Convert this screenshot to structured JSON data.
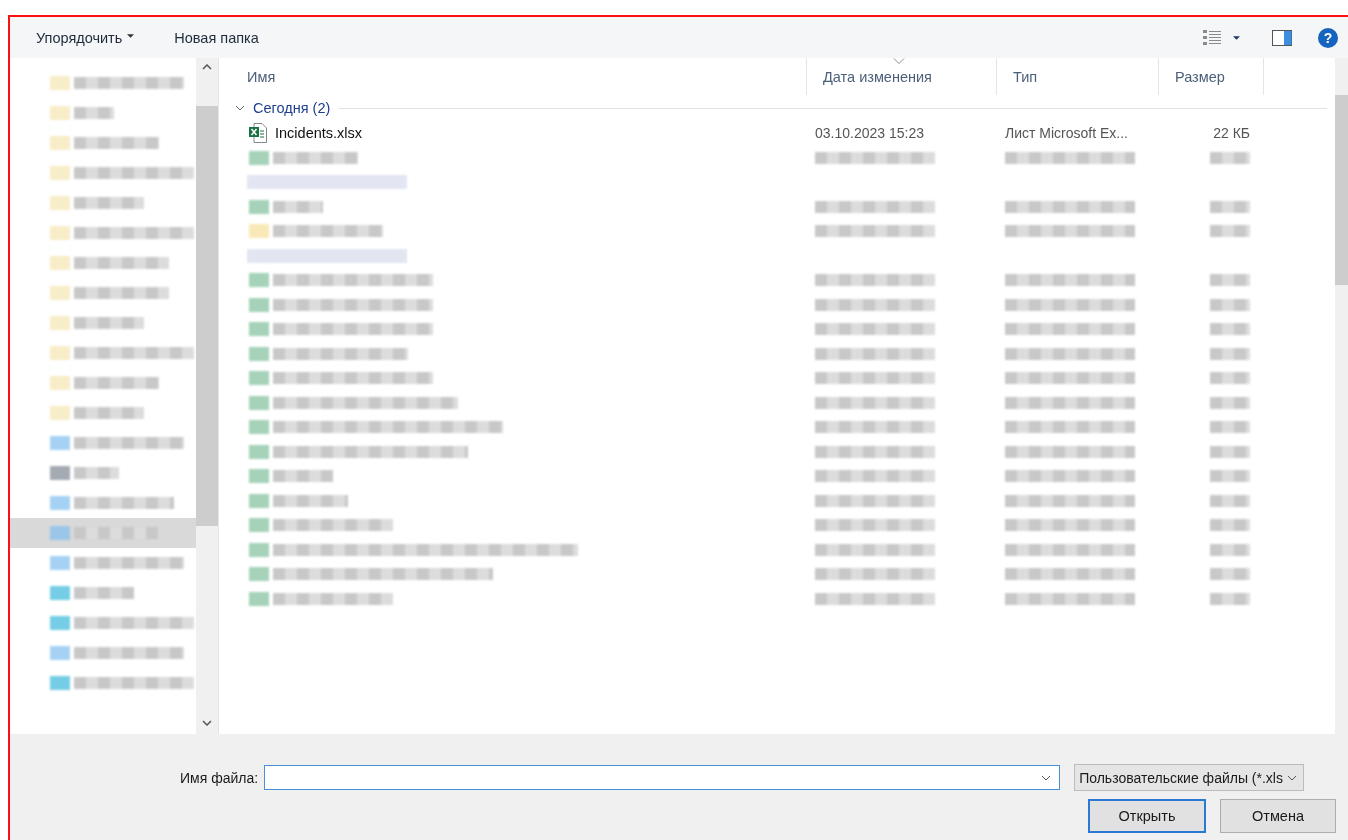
{
  "toolbar": {
    "items": [
      {
        "label": "Упорядочить",
        "kind": "menu"
      },
      {
        "label": "Новая папка",
        "kind": "button"
      }
    ],
    "help": "?"
  },
  "columns": [
    {
      "label": "Имя",
      "sorted": false
    },
    {
      "label": "Дата изменения",
      "sorted": true
    },
    {
      "label": "Тип",
      "sorted": false
    },
    {
      "label": "Размер",
      "sorted": false
    }
  ],
  "groups": [
    {
      "label": "Сегодня (2)",
      "expanded": true,
      "files": [
        {
          "name": "Incidents.xlsx",
          "modified": "03.10.2023 15:23",
          "type": "Лист Microsoft Ex...",
          "size": "22 КБ"
        }
      ]
    }
  ],
  "file_name": {
    "label": "Имя файла:"
  },
  "file_type_filter": "Пользовательские файлы (*.xls",
  "buttons": [
    {
      "label": "Открыть",
      "kind": "default"
    },
    {
      "label": "Отмена",
      "kind": "normal"
    }
  ]
}
